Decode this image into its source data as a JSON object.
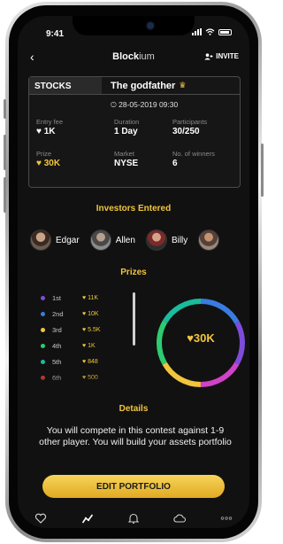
{
  "status_bar": {
    "time": "9:41"
  },
  "header": {
    "brand_bold": "Block",
    "brand_light": "ium",
    "invite_label": "INVITE",
    "back_glyph": "‹"
  },
  "contest": {
    "category": "STOCKS",
    "title": "The godfather",
    "datetime": "28-05-2019  09:30",
    "stats": {
      "entry_fee": {
        "label": "Entry fee",
        "value": "1K"
      },
      "duration": {
        "label": "Duration",
        "value": "1 Day"
      },
      "participants": {
        "label": "Participants",
        "value": "30/250"
      },
      "prize": {
        "label": "Prize",
        "value": "30K"
      },
      "market": {
        "label": "Market",
        "value": "NYSE"
      },
      "winners": {
        "label": "No. of winners",
        "value": "6"
      }
    }
  },
  "investors": {
    "title": "Investors Entered",
    "list": [
      {
        "name": "Edgar"
      },
      {
        "name": "Allen"
      },
      {
        "name": "Billy"
      },
      {
        "name": ""
      }
    ]
  },
  "prizes": {
    "title": "Prizes",
    "rows": [
      {
        "place": "1st",
        "value": "11K",
        "color": "#7d4cdb"
      },
      {
        "place": "2nd",
        "value": "10K",
        "color": "#3a7be0"
      },
      {
        "place": "3rd",
        "value": "5.5K",
        "color": "#f2c53d"
      },
      {
        "place": "4th",
        "value": "1K",
        "color": "#2ecc71"
      },
      {
        "place": "5th",
        "value": "848",
        "color": "#1abc9c"
      },
      {
        "place": "6th",
        "value": "500",
        "color": "#e74c3c"
      }
    ],
    "total": "30K",
    "ring_colors": [
      "#3a7be0",
      "#7d4cdb",
      "#d042c8",
      "#f2c53d",
      "#2ecc71",
      "#1abc9c"
    ]
  },
  "details": {
    "title": "Details",
    "text": "You will compete in this contest against 1-9 other player. You will build your assets portfolio"
  },
  "cta": {
    "label": "EDIT PORTFOLIO"
  },
  "colors": {
    "accent": "#f2c53d",
    "background": "#111111"
  }
}
